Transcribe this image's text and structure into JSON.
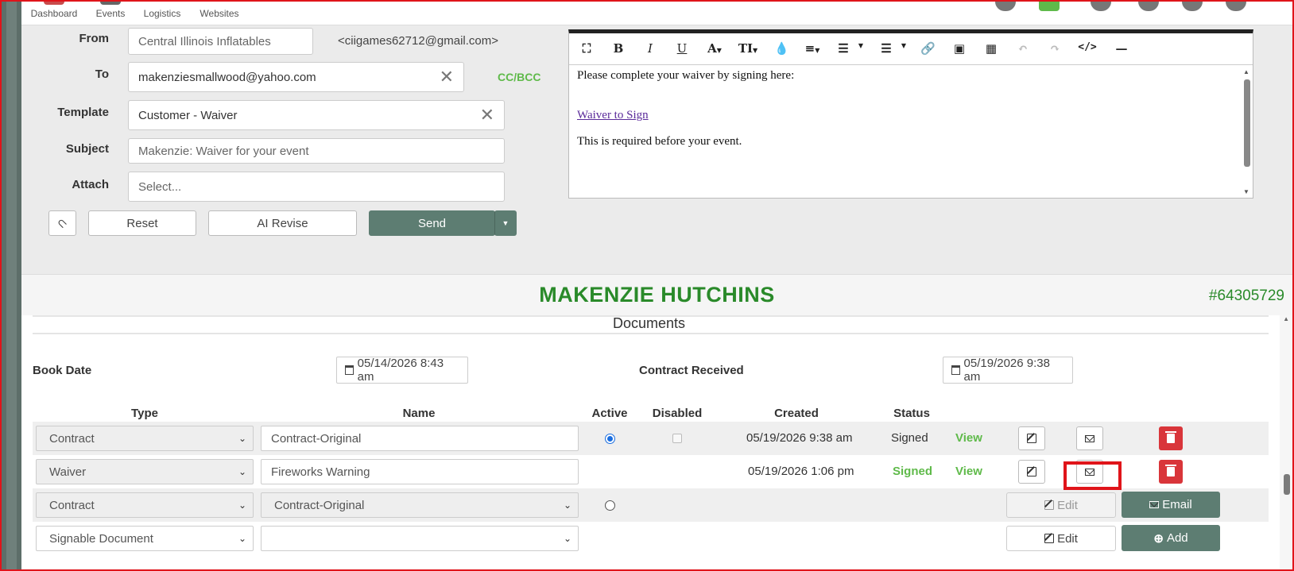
{
  "nav": {
    "items": [
      {
        "label": "Dashboard",
        "icon": "dashboard-icon"
      },
      {
        "label": "Events",
        "icon": "calendar-icon"
      },
      {
        "label": "Logistics",
        "icon": "truck-icon"
      },
      {
        "label": "Websites",
        "icon": "globe-icon"
      }
    ],
    "right_icons": [
      "phone-icon",
      "message-icon",
      "tag-icon",
      "gear-icon",
      "info-icon",
      "user-icon"
    ]
  },
  "composer": {
    "from_label": "From",
    "from_value": "Central Illinois Inflatables",
    "from_email": "<ciigames62712@gmail.com>",
    "to_label": "To",
    "to_value": "makenziesmallwood@yahoo.com",
    "cc_bcc": "CC/BCC",
    "template_label": "Template",
    "template_value": "Customer - Waiver",
    "subject_label": "Subject",
    "subject_value": "Makenzie: Waiver for your event",
    "attach_label": "Attach",
    "attach_placeholder": "Select...",
    "reset_label": "Reset",
    "ai_revise_label": "AI Revise",
    "send_label": "Send"
  },
  "editor": {
    "line1": "Please complete your waiver by signing here:",
    "link_text": "Waiver to Sign",
    "line2": "This is required before your event.",
    "toolbar": {
      "bold": "B",
      "italic": "I",
      "underline": "U",
      "font": "A",
      "size": "TI",
      "code": "</>"
    }
  },
  "customer": {
    "name": "MAKENZIE HUTCHINS",
    "id": "#64305729"
  },
  "documents": {
    "title": "Documents",
    "book_date_label": "Book Date",
    "book_date": "05/14/2026 8:43 am",
    "contract_received_label": "Contract Received",
    "contract_received": "05/19/2026 9:38 am",
    "headers": {
      "type": "Type",
      "name": "Name",
      "active": "Active",
      "disabled": "Disabled",
      "created": "Created",
      "status": "Status"
    },
    "rows": [
      {
        "type": "Contract",
        "name": "Contract-Original",
        "created": "05/19/2026 9:38 am",
        "status": "Signed",
        "view": "View"
      },
      {
        "type": "Waiver",
        "name": "Fireworks Warning",
        "created": "05/19/2026 1:06 pm",
        "status": "Signed",
        "view": "View"
      },
      {
        "type": "Contract",
        "name": "Contract-Original",
        "edit": "Edit",
        "email": "Email"
      },
      {
        "type": "Signable Document",
        "name": "",
        "edit": "Edit",
        "add": "Add"
      }
    ]
  },
  "colors": {
    "accent_green": "#2a8a2a",
    "button_green": "#5d7d72",
    "status_green": "#5fba4a",
    "danger": "#d9353a",
    "highlight": "#e0141a"
  }
}
